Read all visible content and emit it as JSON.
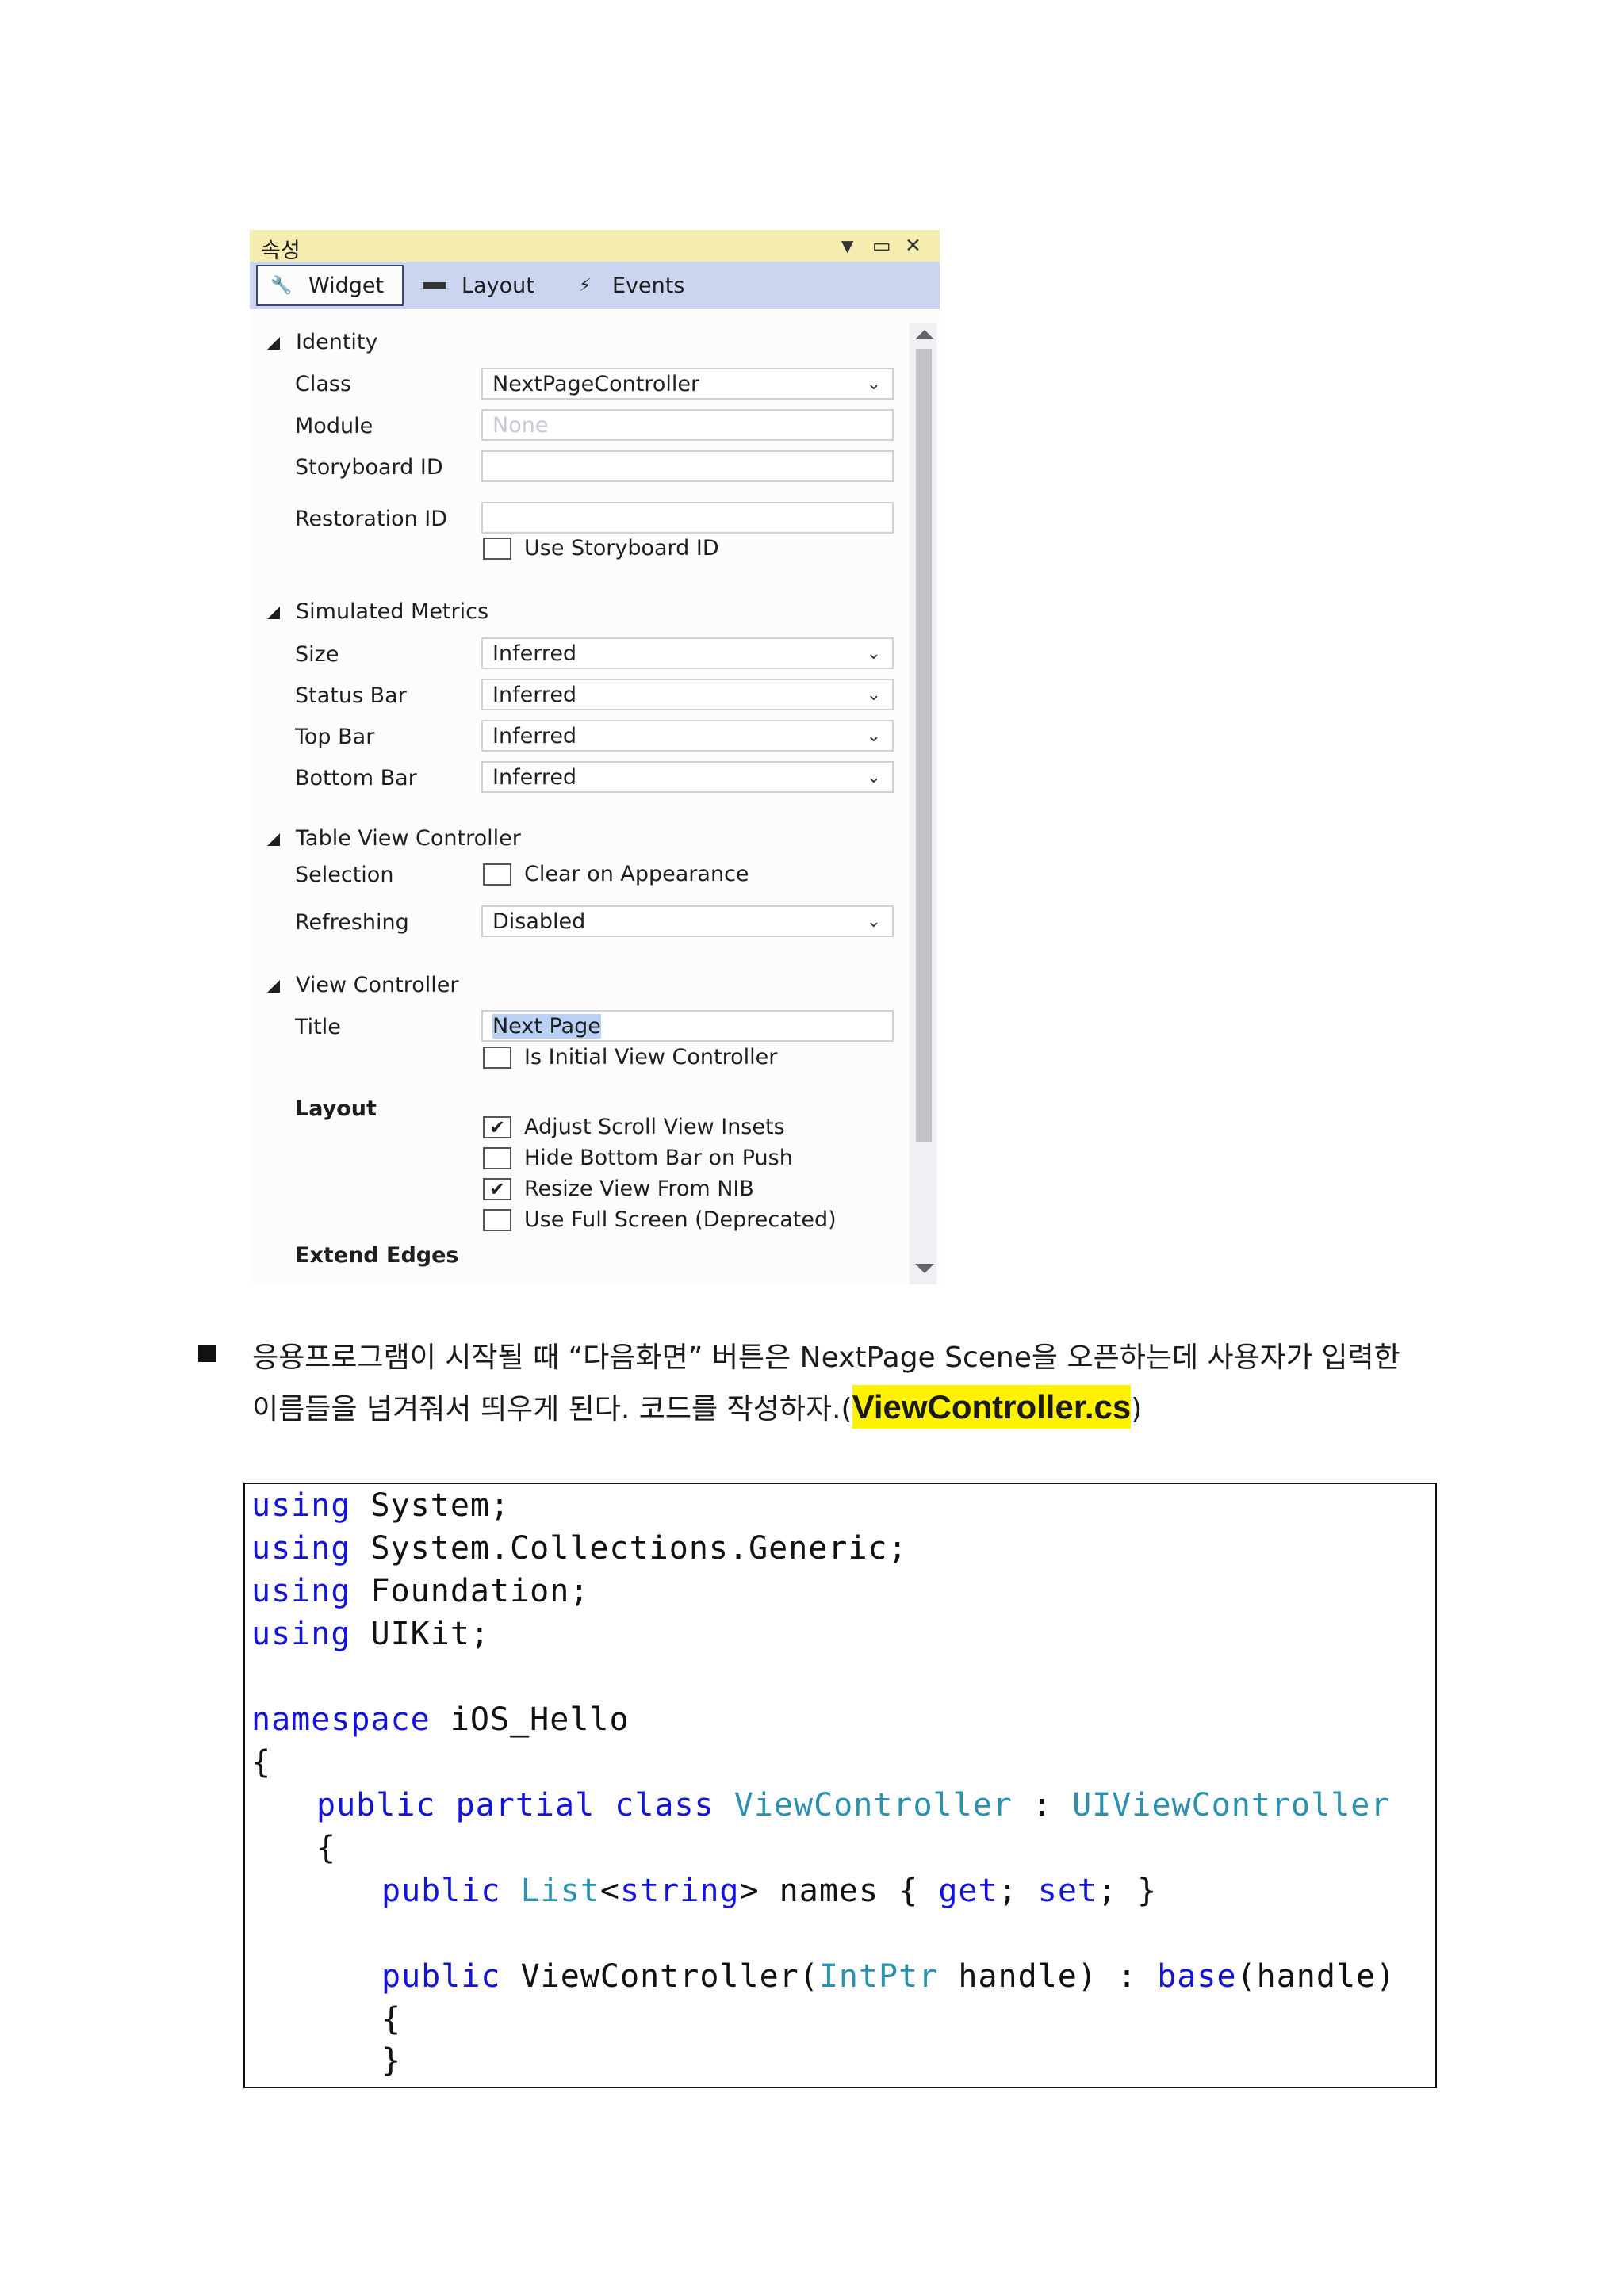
{
  "panel": {
    "title": "속성",
    "tabs": [
      {
        "label": "Widget",
        "icon": "wrench-icon"
      },
      {
        "label": "Layout",
        "icon": "ruler-icon"
      },
      {
        "label": "Events",
        "icon": "lightning-icon"
      }
    ],
    "sections": {
      "identity": {
        "title": "Identity",
        "class_label": "Class",
        "class_value": "NextPageController",
        "module_label": "Module",
        "module_placeholder": "None",
        "storyboard_id_label": "Storyboard ID",
        "storyboard_id_value": "",
        "restoration_id_label": "Restoration ID",
        "restoration_id_value": "",
        "use_storyboard_id": {
          "label": "Use Storyboard ID",
          "checked": false
        }
      },
      "simulated_metrics": {
        "title": "Simulated Metrics",
        "size_label": "Size",
        "size_value": "Inferred",
        "status_bar_label": "Status Bar",
        "status_bar_value": "Inferred",
        "top_bar_label": "Top Bar",
        "top_bar_value": "Inferred",
        "bottom_bar_label": "Bottom Bar",
        "bottom_bar_value": "Inferred"
      },
      "table_view_controller": {
        "title": "Table View Controller",
        "selection_label": "Selection",
        "clear_on_appearance": {
          "label": "Clear on Appearance",
          "checked": false
        },
        "refreshing_label": "Refreshing",
        "refreshing_value": "Disabled"
      },
      "view_controller": {
        "title": "View Controller",
        "title_label": "Title",
        "title_value": "Next Page",
        "is_initial": {
          "label": "Is Initial View Controller",
          "checked": false
        },
        "layout_label": "Layout",
        "adjust_scroll": {
          "label": "Adjust Scroll View Insets",
          "checked": true
        },
        "hide_bottom_bar": {
          "label": "Hide Bottom Bar on Push",
          "checked": false
        },
        "resize_view": {
          "label": "Resize View From NIB",
          "checked": true
        },
        "use_full_screen": {
          "label": "Use Full Screen (Deprecated)",
          "checked": false
        },
        "extend_edges_label": "Extend Edges"
      }
    }
  },
  "paragraph": {
    "bullet": "■",
    "line1": "응용프로그램이 시작될 때 “다음화면” 버튼은 NextPage Scene을 오픈하는데 사용자가 입력한",
    "line2_prefix": "이름들을 넘겨줘서 띄우게 된다. 코드를 작성하자.(",
    "line2_highlight": "ViewController.cs",
    "line2_suffix": ")"
  },
  "code": {
    "line1_kw": "using",
    "line1_rest": " System;",
    "line2_kw": "using",
    "line2_rest": " System.Collections.Generic;",
    "line3_kw": "using",
    "line3_rest": " Foundation;",
    "line4_kw": "using",
    "line4_rest": " UIKit;",
    "line6_kw": "namespace",
    "line6_rest": " iOS_Hello",
    "line7": "{",
    "line8_kw": "public partial class",
    "line8_sp": " ",
    "line8_type": "ViewController",
    "line8_mid": " : ",
    "line8_base": "UIViewController",
    "line9": "{",
    "line10_kw": "public",
    "line10_sp": " ",
    "line10_type": "List",
    "line10_lt": "<",
    "line10_kw2": "string",
    "line10_rest": "> names { ",
    "line10_get": "get",
    "line10_semi": "; ",
    "line10_set": "set",
    "line10_end": "; }",
    "line12_kw": "public",
    "line12_mid": " ViewController(",
    "line12_type": "IntPtr",
    "line12_rest": " handle) : ",
    "line12_base": "base",
    "line12_end": "(handle)",
    "line13": "{",
    "line14": "}"
  },
  "colors": {
    "keyword": "#1414d8",
    "type": "#2b91af",
    "highlight": "#fff200",
    "titlebar": "#f5ecb0",
    "tabbar": "#ccd5f0"
  }
}
